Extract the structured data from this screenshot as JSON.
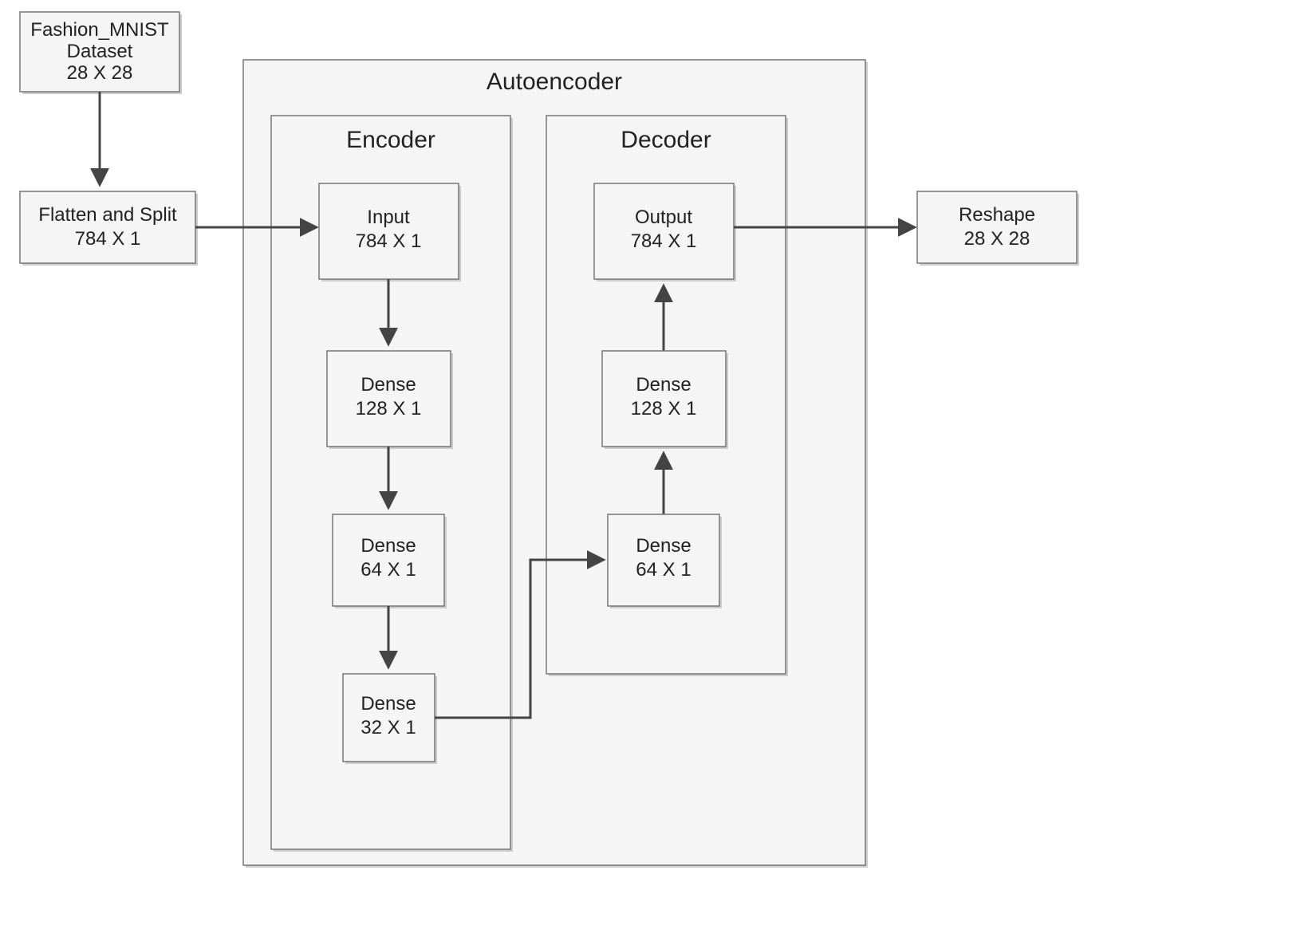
{
  "dataset": {
    "line1": "Fashion_MNIST",
    "line2": "Dataset",
    "line3": "28 X 28"
  },
  "flatten": {
    "line1": "Flatten and Split",
    "line2": "784 X 1"
  },
  "autoencoder_title": "Autoencoder",
  "encoder_title": "Encoder",
  "decoder_title": "Decoder",
  "encoder_layers": [
    {
      "line1": "Input",
      "line2": "784 X 1"
    },
    {
      "line1": "Dense",
      "line2": "128 X 1"
    },
    {
      "line1": "Dense",
      "line2": "64 X 1"
    },
    {
      "line1": "Dense",
      "line2": "32 X 1"
    }
  ],
  "decoder_layers": [
    {
      "line1": "Output",
      "line2": "784 X 1"
    },
    {
      "line1": "Dense",
      "line2": "128 X 1"
    },
    {
      "line1": "Dense",
      "line2": "64 X 1"
    }
  ],
  "reshape": {
    "line1": "Reshape",
    "line2": "28 X 28"
  }
}
